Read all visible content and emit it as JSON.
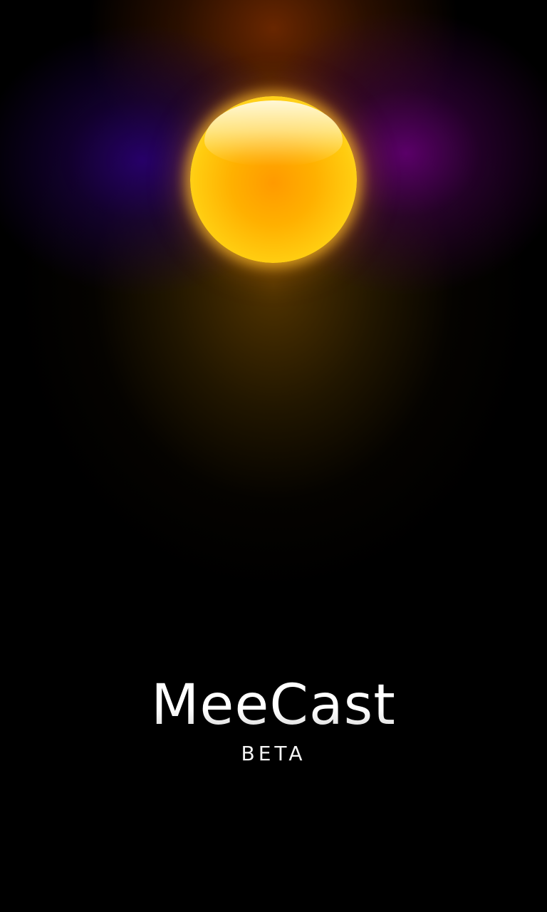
{
  "splash": {
    "app_name": "MeeCast",
    "edition": "BETA",
    "logo_icon": "sun-icon",
    "colors": {
      "background": "#000000",
      "sun_core": "#ff9a00",
      "sun_edge": "#ffe040",
      "glow_left": "#28006e",
      "glow_right": "#5f006e",
      "text": "#f2f2f2"
    }
  }
}
